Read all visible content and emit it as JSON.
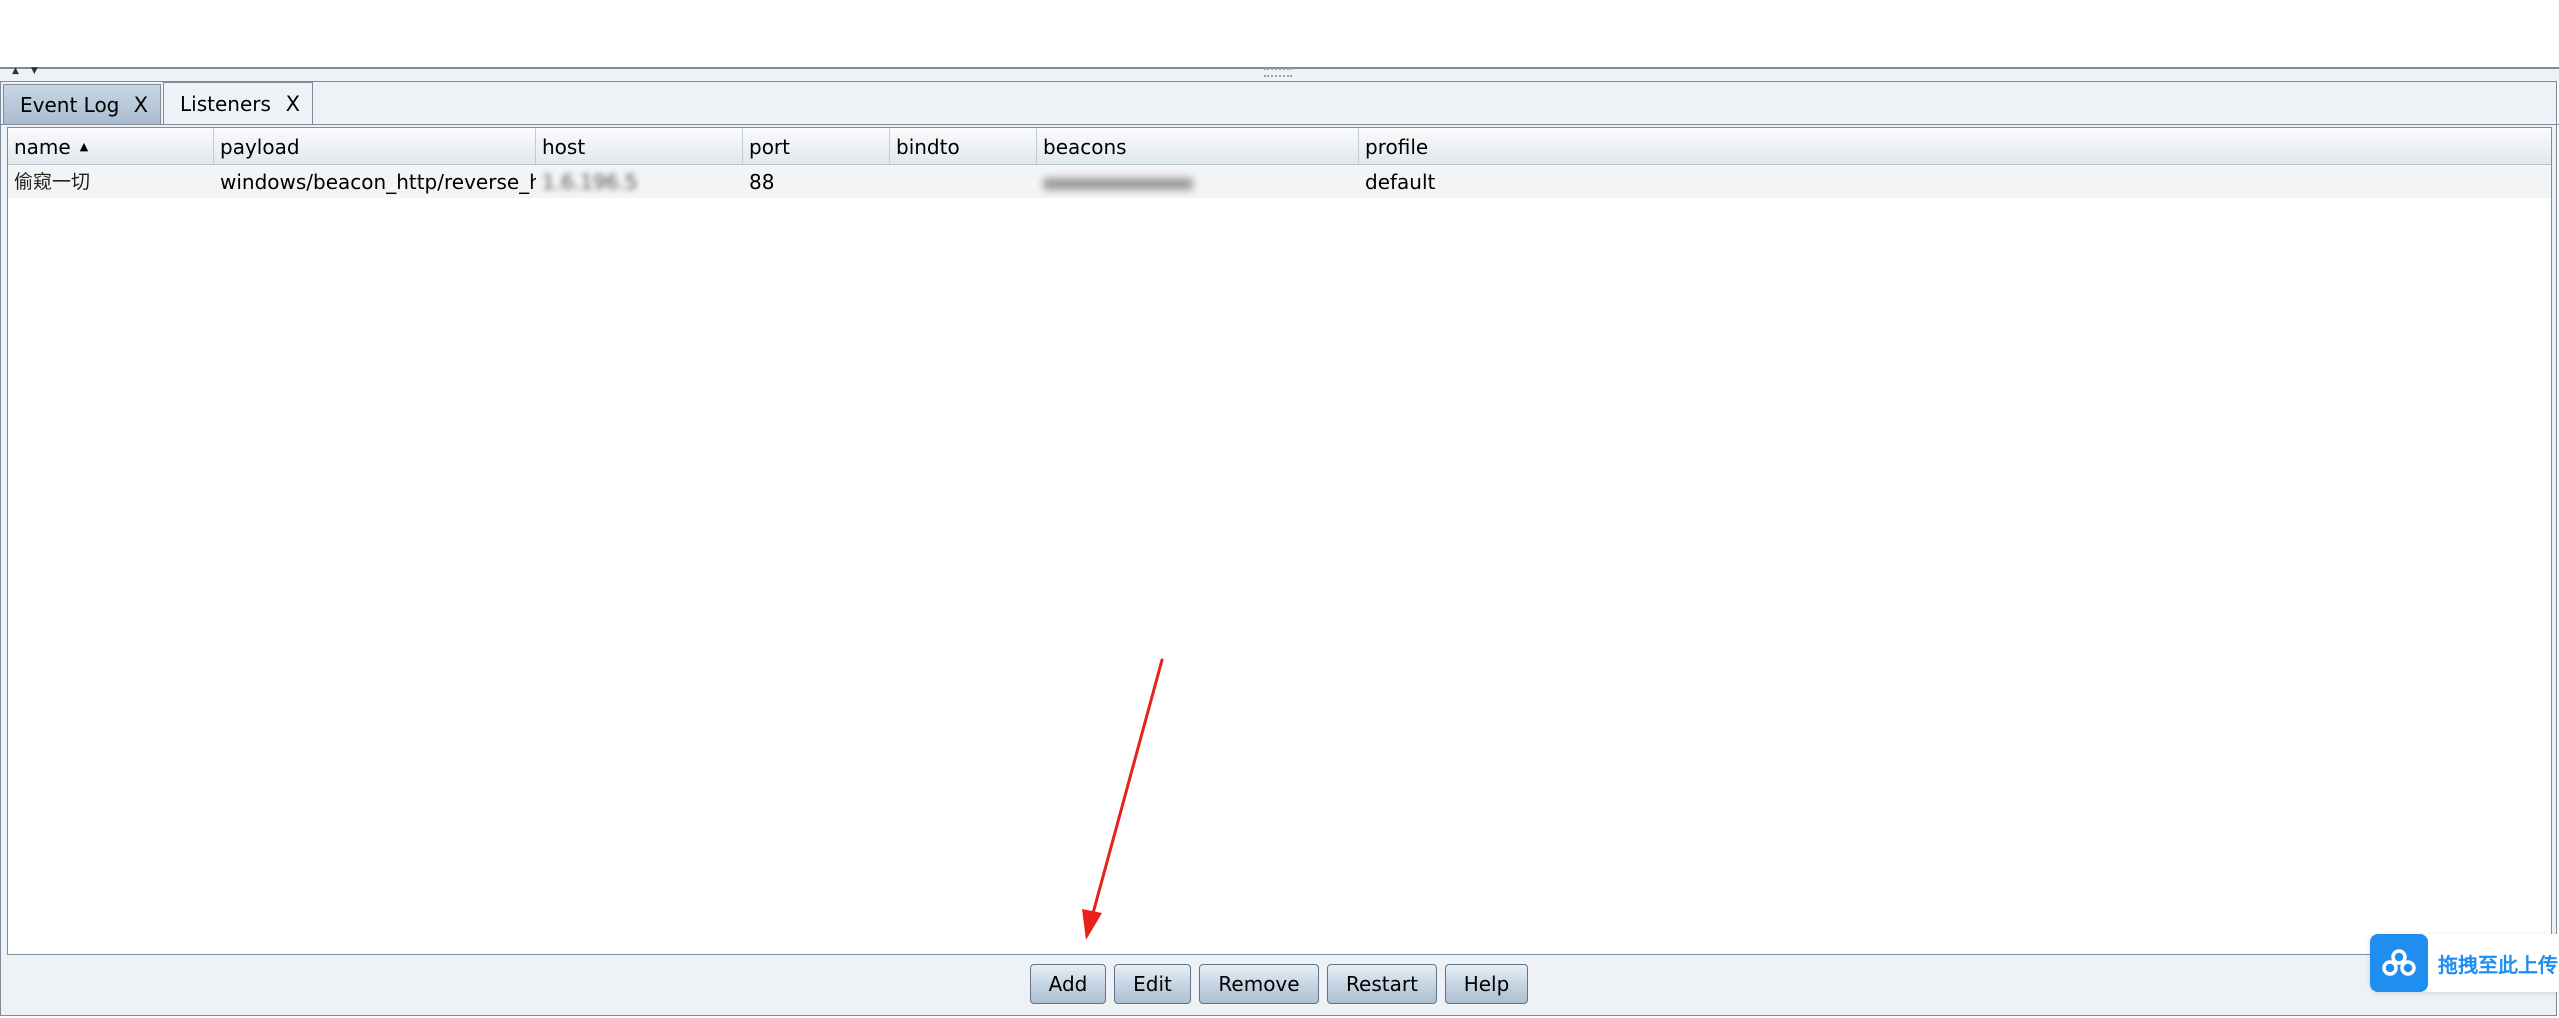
{
  "split_pane": {
    "arrow_up": "▲",
    "arrow_down": "▼"
  },
  "tabs": [
    {
      "label": "Event Log",
      "close": "X",
      "active": false
    },
    {
      "label": "Listeners",
      "close": "X",
      "active": true
    }
  ],
  "table": {
    "sort_indicator": "▲",
    "columns": [
      "name",
      "payload",
      "host",
      "port",
      "bindto",
      "beacons",
      "profile"
    ],
    "rows": [
      {
        "name": "偷窥一切",
        "payload": "windows/beacon_http/reverse_http",
        "host": "1.6.196.5",
        "port": "88",
        "bindto": "",
        "beacons": "",
        "profile": "default"
      }
    ]
  },
  "buttons": {
    "add": "Add",
    "edit": "Edit",
    "remove": "Remove",
    "restart": "Restart",
    "help": "Help"
  },
  "annotation": {
    "arrow_color": "#e8211c",
    "points_to": "add"
  },
  "upload_widget": {
    "label": "拖拽至此上传",
    "icon": "cloud-icon",
    "color": "#1f8ef1"
  }
}
